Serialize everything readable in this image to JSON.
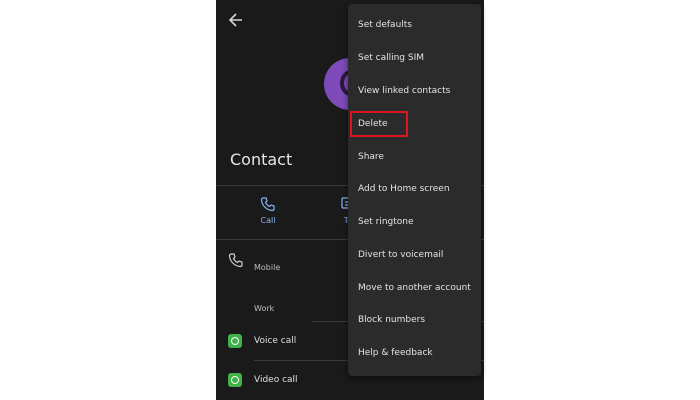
{
  "contact": {
    "title": "Contact",
    "actions": [
      {
        "label": "Call",
        "icon": "phone-icon"
      },
      {
        "label": "Te",
        "icon": "message-icon"
      }
    ],
    "phone_rows": [
      {
        "label": "Mobile",
        "icon": "phone-icon"
      },
      {
        "label": "Work"
      }
    ],
    "whatsapp_rows": [
      {
        "label": "Voice call",
        "icon": "whatsapp-icon"
      },
      {
        "label": "Video call",
        "icon": "whatsapp-icon"
      }
    ]
  },
  "menu": {
    "items": [
      {
        "label": "Set defaults"
      },
      {
        "label": "Set calling SIM"
      },
      {
        "label": "View linked contacts"
      },
      {
        "label": "Delete",
        "highlighted": true
      },
      {
        "label": "Share"
      },
      {
        "label": "Add to Home screen"
      },
      {
        "label": "Set ringtone"
      },
      {
        "label": "Divert to voicemail"
      },
      {
        "label": "Move to another account"
      },
      {
        "label": "Block numbers"
      },
      {
        "label": "Help & feedback"
      }
    ]
  },
  "colors": {
    "background": "#1a1a1a",
    "menu_background": "#2b2b2b",
    "avatar": "#7e49b8",
    "accent": "#8ab4f8",
    "highlight_border": "#e0141e",
    "whatsapp": "#3fb24a"
  }
}
